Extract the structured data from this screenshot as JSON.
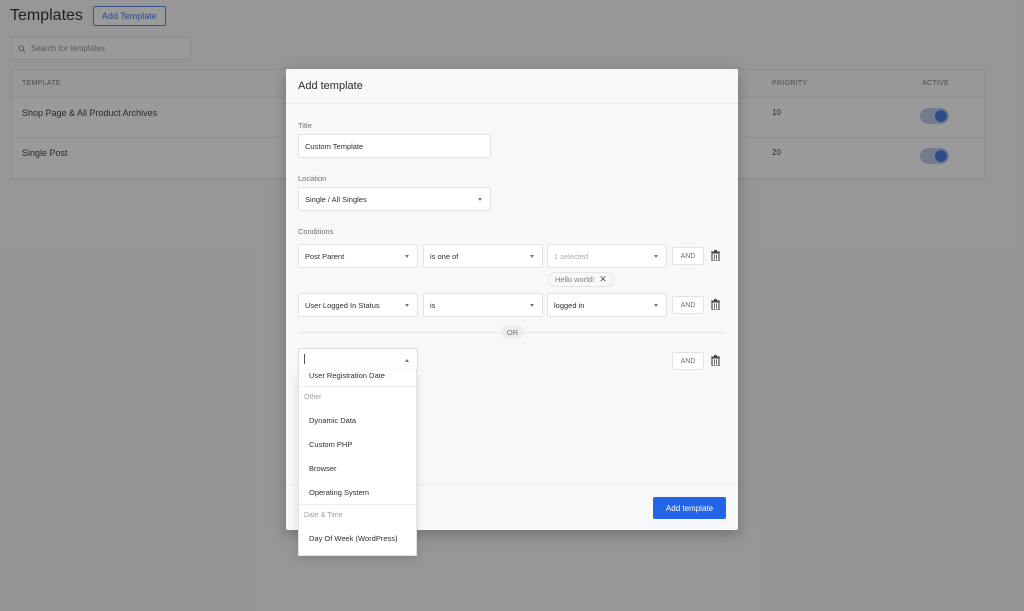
{
  "page": {
    "title": "Templates",
    "add_button": "Add Template",
    "search_placeholder": "Search for templates",
    "table": {
      "headers": {
        "template": "TEMPLATE",
        "priority": "PRIORITY",
        "active": "ACTIVE"
      },
      "rows": [
        {
          "name": "Shop Page & All Product Archives",
          "priority": "10",
          "active": true
        },
        {
          "name": "Single Post",
          "priority": "20",
          "active": true
        }
      ]
    }
  },
  "modal": {
    "title": "Add template",
    "title_label": "Title",
    "title_value": "Custom Template",
    "location_label": "Location",
    "location_value": "Single / All Singles",
    "conditions_label": "Conditions",
    "conditions": [
      {
        "field": "Post Parent",
        "operator": "is one of",
        "value": "1 selected",
        "value_is_placeholder": true,
        "chips": [
          "Hello world!"
        ],
        "and_label": "AND"
      },
      {
        "field": "User Logged In Status",
        "operator": "is",
        "value": "logged in",
        "value_is_placeholder": false,
        "chips": [],
        "and_label": "AND"
      }
    ],
    "or_label": "OR",
    "new_group": {
      "field": "",
      "and_label": "AND"
    },
    "submit_label": "Add template"
  },
  "dropdown": {
    "items": [
      {
        "type": "item",
        "label": "User Registration Date"
      },
      {
        "type": "group",
        "label": "Other"
      },
      {
        "type": "item",
        "label": "Dynamic Data"
      },
      {
        "type": "item",
        "label": "Custom PHP"
      },
      {
        "type": "item",
        "label": "Browser"
      },
      {
        "type": "item",
        "label": "Operating System"
      },
      {
        "type": "group",
        "label": "Date & Time"
      },
      {
        "type": "item",
        "label": "Day Of Week (WordPress)"
      }
    ]
  },
  "colors": {
    "accent": "#2365e6",
    "toggle_on": "#3b74db"
  }
}
